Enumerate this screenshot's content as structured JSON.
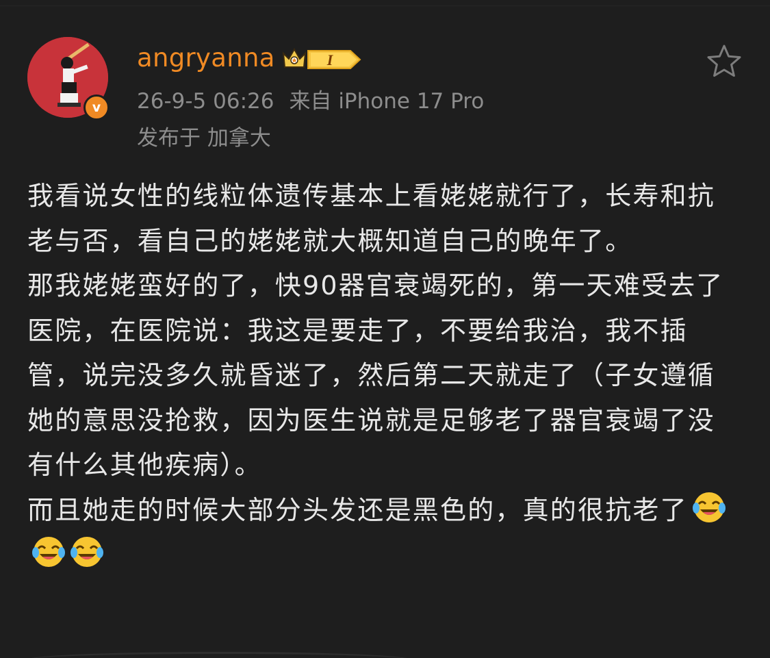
{
  "post": {
    "author": {
      "username": "angryanna",
      "level": "I"
    },
    "meta": {
      "timestamp": "26-9-5 06:26",
      "source": "来自 iPhone 17 Pro",
      "location": "发布于 加拿大"
    },
    "paragraphs": [
      "我看说女性的线粒体遗传基本上看姥姥就行了，长寿和抗老与否，看自己的姥姥就大概知道自己的晚年了。",
      "那我姥姥蛮好的了，快90器官衰竭死的，第一天难受去了医院，在医院说：我这是要走了，不要给我治，我不插管，说完没多久就昏迷了，然后第二天就走了（子女遵循她的意思没抢救，因为医生说就是足够老了器官衰竭了没有什么其他疾病）。",
      "而且她走的时候大部分头发还是黑色的，真的很抗老了"
    ],
    "trailing_emojis": [
      "laughing-crying-icon",
      "laughing-crying-icon",
      "laughing-crying-icon"
    ]
  },
  "theme": {
    "background": "#1e1e1e",
    "username_color": "#f08a24",
    "meta_color": "#8d8d8d",
    "text_color": "#e8e8e8",
    "verified_badge_color": "#f08a24",
    "avatar_bg": "#c8333a"
  },
  "icons": {
    "verified": "verified-v-icon",
    "level": "crown-level-badge-icon",
    "favorite": "star-outline-icon"
  }
}
